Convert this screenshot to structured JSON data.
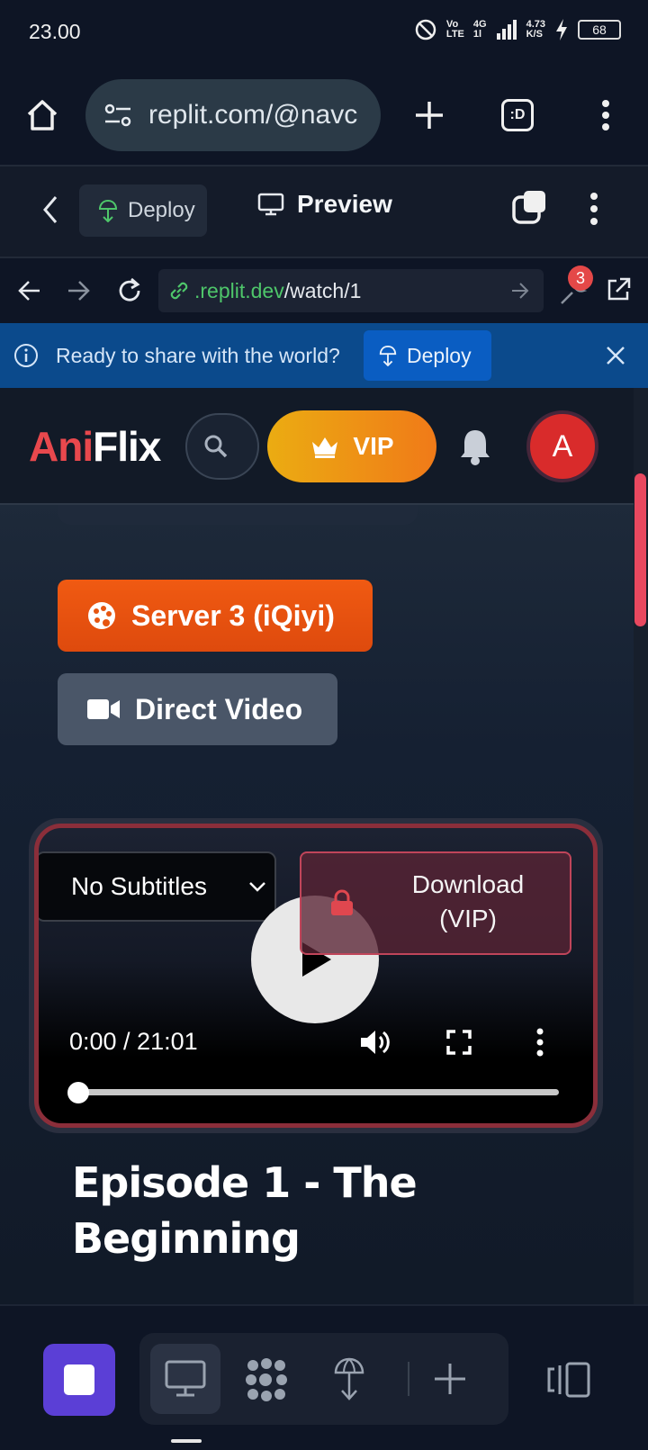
{
  "status_bar": {
    "time": "23.00",
    "net_top": "Vo",
    "net_bottom": "LTE",
    "gen_top": "4G",
    "gen_bottom": "1l",
    "speed_top": "4.73",
    "speed_bottom": "K/S",
    "battery": "68"
  },
  "browser": {
    "url": "replit.com/@navc",
    "tab_count_label": ":D"
  },
  "replit_toolbar": {
    "deploy_label": "Deploy",
    "preview_label": "Preview"
  },
  "webview_nav": {
    "url_domain": ".replit.dev",
    "url_path": "/watch/1",
    "devtools_badge": "3"
  },
  "banner": {
    "message": "Ready to share with the world?",
    "deploy_label": "Deploy"
  },
  "site": {
    "logo_part1": "Ani",
    "logo_part2": "Flix",
    "vip_label": "VIP",
    "avatar_letter": "A",
    "server_button": "Server 3 (iQiyi)",
    "direct_video_button": "Direct Video",
    "episode_title": "Episode 1 - The Beginning"
  },
  "player": {
    "subtitle_selected": "No Subtitles",
    "download_label": "Download (VIP)",
    "time_display": "0:00 / 21:01",
    "progress_fraction": 0
  },
  "colors": {
    "brand_red": "#e8484d",
    "vip_gradient_start": "#ebac12",
    "vip_gradient_end": "#f07a18",
    "server_orange": "#f05a12",
    "replit_purple": "#5b3fd6",
    "banner_blue": "#0b4a8c"
  },
  "icons": {
    "status": [
      "dnd-icon",
      "signal-icon",
      "charging-icon",
      "battery-icon"
    ],
    "browser": [
      "home-icon",
      "site-settings-icon",
      "new-tab-icon",
      "tabs-icon",
      "menu-icon"
    ],
    "replit": [
      "back-icon",
      "deploy-icon",
      "monitor-icon",
      "new-window-icon",
      "more-icon"
    ],
    "nav": [
      "arrow-left-icon",
      "arrow-right-icon",
      "reload-icon",
      "link-icon",
      "go-icon",
      "devtools-icon",
      "external-link-icon"
    ],
    "player": [
      "lock-icon",
      "play-icon",
      "volume-icon",
      "fullscreen-icon",
      "more-vertical-icon"
    ],
    "bottom": [
      "stop-icon",
      "preview-icon",
      "agent-icon",
      "deploy-icon",
      "plus-icon",
      "panel-toggle-icon"
    ]
  }
}
